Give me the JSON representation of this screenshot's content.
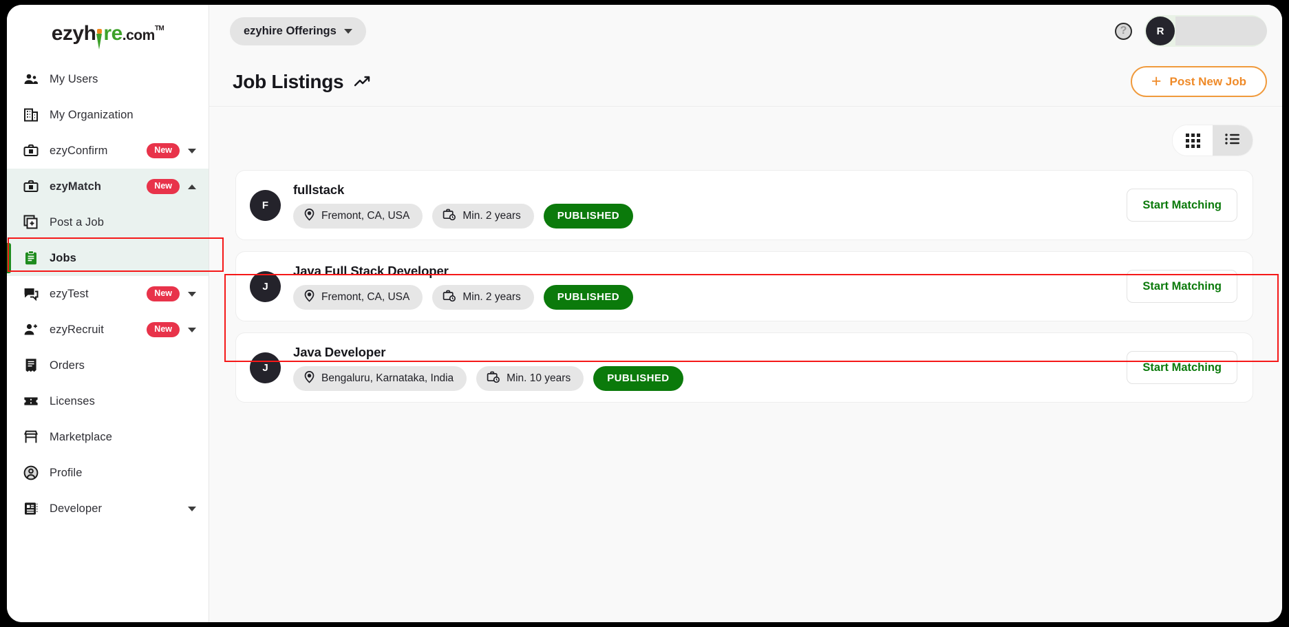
{
  "brand": {
    "logo_part1": "ezyh",
    "logo_part2": "re",
    "logo_dot": ".",
    "logo_com": "com",
    "logo_tm": "TM"
  },
  "sidebar": {
    "items": [
      {
        "label": "My Users",
        "icon": "users-icon",
        "badge": null,
        "caret": null
      },
      {
        "label": "My Organization",
        "icon": "building-icon",
        "badge": null,
        "caret": null
      },
      {
        "label": "ezyConfirm",
        "icon": "briefcase-icon",
        "badge": "New",
        "caret": "down"
      },
      {
        "label": "ezyMatch",
        "icon": "briefcase-icon",
        "badge": "New",
        "caret": "up"
      },
      {
        "label": "Post a Job",
        "icon": "add-document-icon",
        "badge": null,
        "caret": null
      },
      {
        "label": "Jobs",
        "icon": "clipboard-icon",
        "badge": null,
        "caret": null
      },
      {
        "label": "ezyTest",
        "icon": "chat-icon",
        "badge": "New",
        "caret": "down"
      },
      {
        "label": "ezyRecruit",
        "icon": "user-add-icon",
        "badge": "New",
        "caret": "down"
      },
      {
        "label": "Orders",
        "icon": "receipt-icon",
        "badge": null,
        "caret": null
      },
      {
        "label": "Licenses",
        "icon": "ticket-icon",
        "badge": null,
        "caret": null
      },
      {
        "label": "Marketplace",
        "icon": "store-icon",
        "badge": null,
        "caret": null
      },
      {
        "label": "Profile",
        "icon": "profile-icon",
        "badge": null,
        "caret": null
      },
      {
        "label": "Developer",
        "icon": "developer-icon",
        "badge": null,
        "caret": "down"
      }
    ]
  },
  "topbar": {
    "offerings_label": "ezyhire Offerings",
    "help_glyph": "?",
    "avatar_initial": "R"
  },
  "page": {
    "title": "Job Listings",
    "post_button_label": "Post New Job",
    "post_button_plus": "+",
    "accent_orange": "#ef8a28",
    "accent_green": "#0b7a0b",
    "badge_red": "#e8334a"
  },
  "view_toggle": {
    "grid_label": "grid-view",
    "list_label": "list-view",
    "selected": "list"
  },
  "jobs": [
    {
      "initial": "F",
      "title": "fullstack",
      "location": "Fremont, CA, USA",
      "experience": "Min. 2 years",
      "status": "PUBLISHED",
      "action": "Start Matching"
    },
    {
      "initial": "J",
      "title": "Java Full Stack Developer",
      "location": "Fremont, CA, USA",
      "experience": "Min. 2 years",
      "status": "PUBLISHED",
      "action": "Start Matching"
    },
    {
      "initial": "J",
      "title": "Java Developer",
      "location": "Bengaluru, Karnataka, India",
      "experience": "Min. 10 years",
      "status": "PUBLISHED",
      "action": "Start Matching"
    }
  ]
}
